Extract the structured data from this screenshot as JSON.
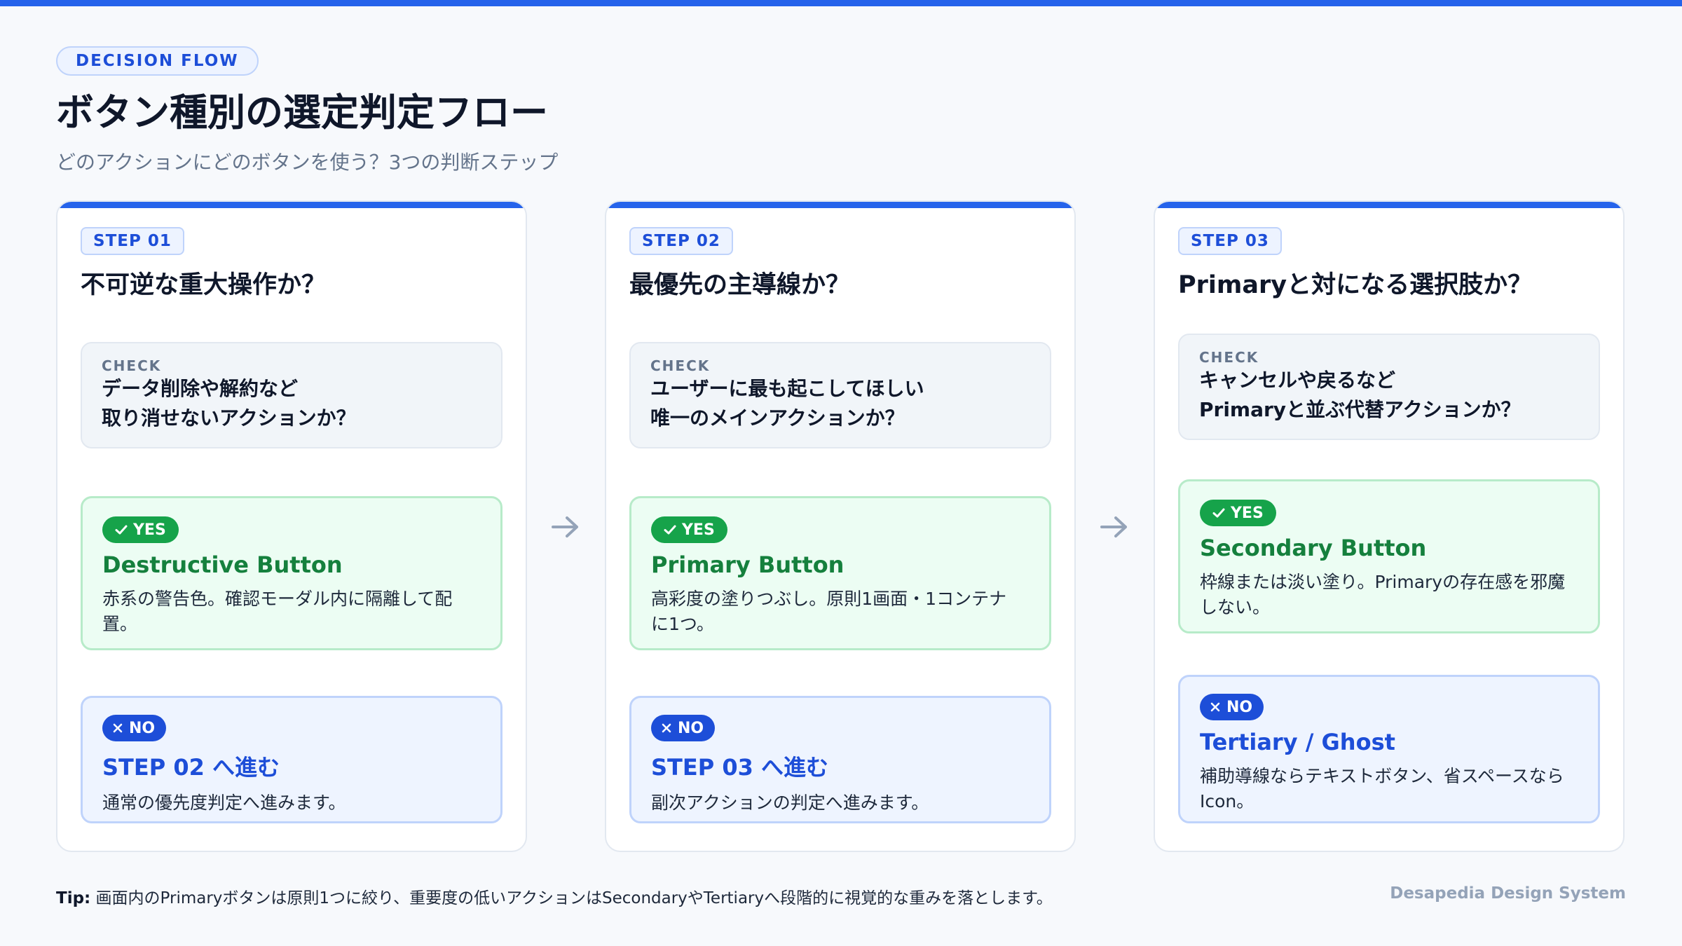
{
  "eyebrow": "DECISION FLOW",
  "title": "ボタン種別の選定判定フロー",
  "subtitle": "どのアクションにどのボタンを使う？3つの判断ステップ",
  "check_label": "CHECK",
  "yes_label": "YES",
  "no_label": "NO",
  "steps": [
    {
      "badge": "STEP 01",
      "question": "不可逆な重大操作か？",
      "check_lines": [
        "データ削除や解約など",
        "取り消せないアクションか？"
      ],
      "yes_title": "Destructive Button",
      "yes_desc": [
        "赤系の警告色。確認モーダル内に隔離して配",
        "置。"
      ],
      "no_title": "STEP 02 へ進む",
      "no_desc": [
        "通常の優先度判定へ進みます。"
      ]
    },
    {
      "badge": "STEP 02",
      "question": "最優先の主導線か？",
      "check_lines": [
        "ユーザーに最も起こしてほしい",
        "唯一のメインアクションか？"
      ],
      "yes_title": "Primary Button",
      "yes_desc": [
        "高彩度の塗りつぶし。原則1画面・1コンテナ",
        "に1つ。"
      ],
      "no_title": "STEP 03 へ進む",
      "no_desc": [
        "副次アクションの判定へ進みます。"
      ]
    },
    {
      "badge": "STEP 03",
      "question": "Primaryと対になる選択肢か？",
      "check_lines": [
        "キャンセルや戻るなど",
        "Primaryと並ぶ代替アクションか？"
      ],
      "yes_title": "Secondary Button",
      "yes_desc": [
        "枠線または淡い塗り。Primaryの存在感を邪魔",
        "しない。"
      ],
      "no_title": "Tertiary / Ghost",
      "no_desc": [
        "補助導線ならテキストボタン、省スペースなら",
        "Icon。"
      ]
    }
  ],
  "footer": {
    "tip_label": "Tip:",
    "tip_text": " 画面内のPrimaryボタンは原則1つに絞り、重要度の低いアクションはSecondaryやTertiaryへ段階的に視覚的な重みを落とします。",
    "credit": "Desapedia Design System"
  },
  "colors": {
    "accent": "#2563eb",
    "yes": "#16a34a",
    "no": "#1d4ed8",
    "muted": "#64748b"
  }
}
